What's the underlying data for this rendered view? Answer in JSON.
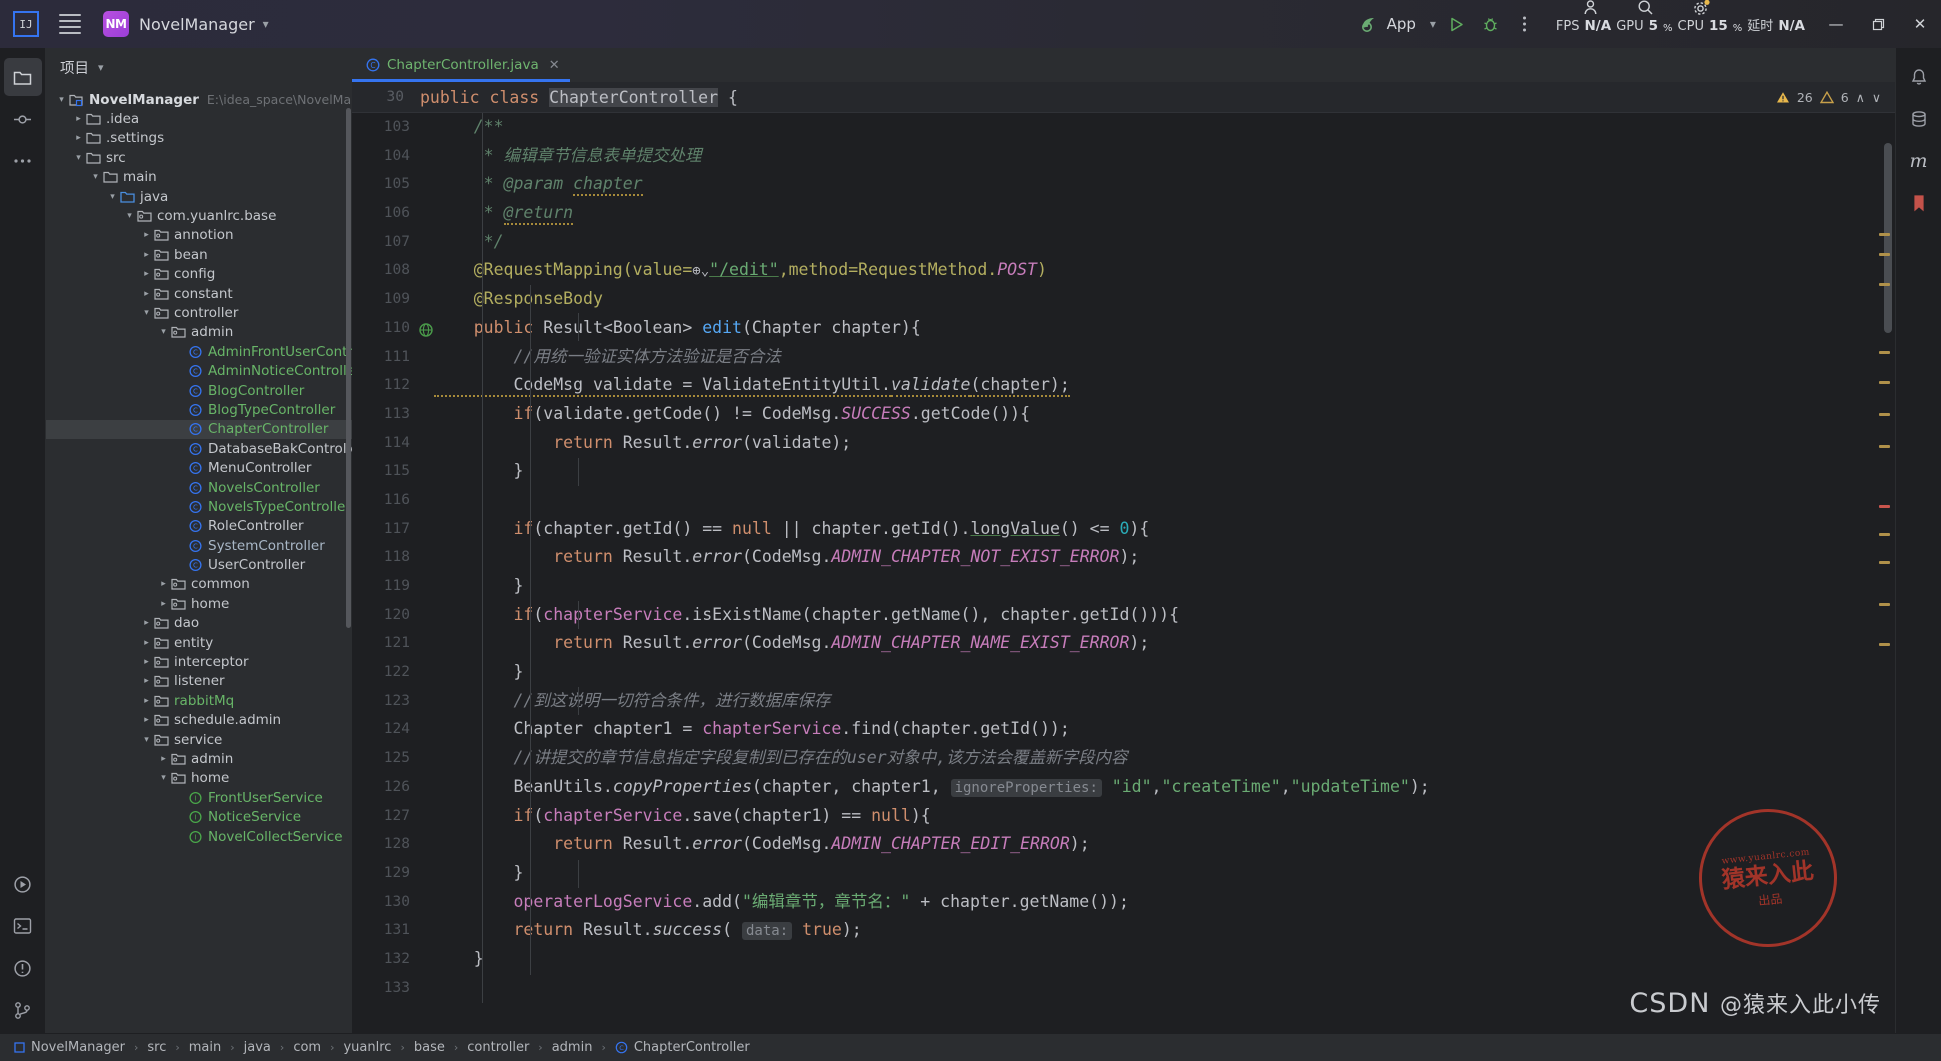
{
  "titlebar": {
    "ide_icon": "intellij-idea-icon",
    "menu_icon": "hamburger-menu-icon",
    "project_initials": "NM",
    "project_name": "NovelManager",
    "run_config": "App",
    "run_icon": "run-icon",
    "debug_icon": "debug-icon",
    "more_icon": "more-vertical-icon",
    "account_icon": "account-icon",
    "search_icon": "search-icon",
    "settings_icon": "gear-icon",
    "perf": [
      {
        "label": "FPS",
        "value": "N/A"
      },
      {
        "label": "GPU",
        "value": "5",
        "unit": "%"
      },
      {
        "label": "CPU",
        "value": "15",
        "unit": "%"
      },
      {
        "label": "延时",
        "value": "N/A"
      }
    ],
    "minimize": "—",
    "maximize": "❐",
    "close": "✕"
  },
  "left_stripe": [
    {
      "name": "project-tool-button",
      "icon": "folder-icon",
      "active": true
    },
    {
      "name": "commit-tool-button",
      "icon": "commit-icon",
      "active": false
    },
    {
      "name": "more-tool-button",
      "icon": "ellipsis-icon",
      "active": false
    },
    {
      "name": "run-tool-button",
      "icon": "run-circle-icon",
      "active": false
    },
    {
      "name": "terminal-tool-button",
      "icon": "terminal-icon",
      "active": false
    },
    {
      "name": "problems-tool-button",
      "icon": "problems-icon",
      "active": false
    },
    {
      "name": "git-tool-button",
      "icon": "git-branch-icon",
      "active": false
    }
  ],
  "right_stripe": [
    {
      "name": "notifications-tool-button",
      "icon": "bell-icon"
    },
    {
      "name": "database-tool-button",
      "icon": "database-icon"
    },
    {
      "name": "maven-tool-button",
      "icon": "maven-m-icon"
    },
    {
      "name": "bookmarks-tool-button",
      "icon": "bookmark-icon"
    }
  ],
  "project_panel": {
    "title": "项目",
    "chevron": "⌄",
    "tree": [
      {
        "depth": 0,
        "arrow": "down",
        "icon": "module-icon",
        "label": "NovelManager",
        "bold": true,
        "path": "E:\\idea_space\\NovelManager",
        "selected": false
      },
      {
        "depth": 1,
        "arrow": "right",
        "icon": "folder-icon",
        "label": ".idea",
        "color": "default"
      },
      {
        "depth": 1,
        "arrow": "right",
        "icon": "folder-icon",
        "label": ".settings",
        "color": "default"
      },
      {
        "depth": 1,
        "arrow": "down",
        "icon": "folder-icon",
        "label": "src",
        "color": "default"
      },
      {
        "depth": 2,
        "arrow": "down",
        "icon": "folder-icon",
        "label": "main",
        "color": "default"
      },
      {
        "depth": 3,
        "arrow": "down",
        "icon": "source-folder-icon",
        "label": "java",
        "color": "default"
      },
      {
        "depth": 4,
        "arrow": "down",
        "icon": "package-icon",
        "label": "com.yuanlrc.base",
        "color": "default"
      },
      {
        "depth": 5,
        "arrow": "right",
        "icon": "package-icon",
        "label": "annotion",
        "color": "default"
      },
      {
        "depth": 5,
        "arrow": "right",
        "icon": "package-icon",
        "label": "bean",
        "color": "default"
      },
      {
        "depth": 5,
        "arrow": "right",
        "icon": "package-icon",
        "label": "config",
        "color": "default"
      },
      {
        "depth": 5,
        "arrow": "right",
        "icon": "package-icon",
        "label": "constant",
        "color": "default"
      },
      {
        "depth": 5,
        "arrow": "down",
        "icon": "package-icon",
        "label": "controller",
        "color": "default"
      },
      {
        "depth": 6,
        "arrow": "down",
        "icon": "package-icon",
        "label": "admin",
        "color": "default"
      },
      {
        "depth": 7,
        "arrow": "none",
        "icon": "class-icon",
        "label": "AdminFrontUserController",
        "color": "green"
      },
      {
        "depth": 7,
        "arrow": "none",
        "icon": "class-icon",
        "label": "AdminNoticeController",
        "color": "green"
      },
      {
        "depth": 7,
        "arrow": "none",
        "icon": "class-icon",
        "label": "BlogController",
        "color": "green"
      },
      {
        "depth": 7,
        "arrow": "none",
        "icon": "class-icon",
        "label": "BlogTypeController",
        "color": "green"
      },
      {
        "depth": 7,
        "arrow": "none",
        "icon": "class-icon",
        "label": "ChapterController",
        "color": "green",
        "selected": true
      },
      {
        "depth": 7,
        "arrow": "none",
        "icon": "class-icon",
        "label": "DatabaseBakController",
        "color": "default"
      },
      {
        "depth": 7,
        "arrow": "none",
        "icon": "class-icon",
        "label": "MenuController",
        "color": "default"
      },
      {
        "depth": 7,
        "arrow": "none",
        "icon": "class-icon",
        "label": "NovelsController",
        "color": "green"
      },
      {
        "depth": 7,
        "arrow": "none",
        "icon": "class-icon",
        "label": "NovelsTypeController",
        "color": "green"
      },
      {
        "depth": 7,
        "arrow": "none",
        "icon": "class-icon",
        "label": "RoleController",
        "color": "default"
      },
      {
        "depth": 7,
        "arrow": "none",
        "icon": "class-icon",
        "label": "SystemController",
        "color": "blue"
      },
      {
        "depth": 7,
        "arrow": "none",
        "icon": "class-icon",
        "label": "UserController",
        "color": "default"
      },
      {
        "depth": 6,
        "arrow": "right",
        "icon": "package-icon",
        "label": "common",
        "color": "default"
      },
      {
        "depth": 6,
        "arrow": "right",
        "icon": "package-icon",
        "label": "home",
        "color": "default"
      },
      {
        "depth": 5,
        "arrow": "right",
        "icon": "package-icon",
        "label": "dao",
        "color": "default"
      },
      {
        "depth": 5,
        "arrow": "right",
        "icon": "package-icon",
        "label": "entity",
        "color": "default"
      },
      {
        "depth": 5,
        "arrow": "right",
        "icon": "package-icon",
        "label": "interceptor",
        "color": "default"
      },
      {
        "depth": 5,
        "arrow": "right",
        "icon": "package-icon",
        "label": "listener",
        "color": "default"
      },
      {
        "depth": 5,
        "arrow": "right",
        "icon": "package-icon",
        "label": "rabbitMq",
        "color": "green"
      },
      {
        "depth": 5,
        "arrow": "right",
        "icon": "package-icon",
        "label": "schedule.admin",
        "color": "default"
      },
      {
        "depth": 5,
        "arrow": "down",
        "icon": "package-icon",
        "label": "service",
        "color": "default"
      },
      {
        "depth": 6,
        "arrow": "right",
        "icon": "package-icon",
        "label": "admin",
        "color": "default"
      },
      {
        "depth": 6,
        "arrow": "down",
        "icon": "package-icon",
        "label": "home",
        "color": "default"
      },
      {
        "depth": 7,
        "arrow": "none",
        "icon": "interface-icon",
        "label": "FrontUserService",
        "color": "green"
      },
      {
        "depth": 7,
        "arrow": "none",
        "icon": "interface-icon",
        "label": "NoticeService",
        "color": "green"
      },
      {
        "depth": 7,
        "arrow": "none",
        "icon": "interface-icon",
        "label": "NovelCollectService",
        "color": "green"
      }
    ]
  },
  "editor": {
    "tab": {
      "label": "ChapterController.java",
      "icon": "java-class-icon",
      "close": "✕"
    },
    "sticky_line_number": "30",
    "inspections": {
      "warnings": "26",
      "weak_warnings": "6",
      "warning_icon": "warning-triangle-icon",
      "weak_icon": "weak-warning-icon",
      "up": "∧",
      "down": "∨"
    },
    "first_line": 103,
    "lines": [
      "103",
      "104",
      "105",
      "106",
      "107",
      "108",
      "109",
      "110",
      "111",
      "112",
      "113",
      "114",
      "115",
      "116",
      "117",
      "118",
      "119",
      "120",
      "121",
      "122",
      "123",
      "124",
      "125",
      "126",
      "127",
      "128",
      "129",
      "130",
      "131",
      "132",
      "133"
    ],
    "code_text": {
      "l103": "    /**",
      "l104": "     * 编辑章节信息表单提交处理",
      "l105": "     * @param chapter",
      "l106": "     * @return",
      "l107": "     */",
      "l108": "    @RequestMapping(value=\"/edit\",method=RequestMethod.POST)",
      "l109": "    @ResponseBody",
      "l110": "    public Result<Boolean> edit(Chapter chapter){",
      "l111": "        //用统一验证实体方法验证是否合法",
      "l112": "        CodeMsg validate = ValidateEntityUtil.validate(chapter);",
      "l113": "        if(validate.getCode() != CodeMsg.SUCCESS.getCode()){",
      "l114": "            return Result.error(validate);",
      "l115": "        }",
      "l116": "",
      "l117": "        if(chapter.getId() == null || chapter.getId().longValue() <= 0){",
      "l118": "            return Result.error(CodeMsg.ADMIN_CHAPTER_NOT_EXIST_ERROR);",
      "l119": "        }",
      "l120": "        if(chapterService.isExistName(chapter.getName(), chapter.getId())){",
      "l121": "            return Result.error(CodeMsg.ADMIN_CHAPTER_NAME_EXIST_ERROR);",
      "l122": "        }",
      "l123": "        //到这说明一切符合条件，进行数据库保存",
      "l124": "        Chapter chapter1 = chapterService.find(chapter.getId());",
      "l125": "        //讲提交的章节信息指定字段复制到已存在的user对象中,该方法会覆盖新字段内容",
      "l126": "        BeanUtils.copyProperties(chapter, chapter1, ignoreProperties: \"id\",\"createTime\",\"updateTime\");",
      "l127": "        if(chapterService.save(chapter1) == null){",
      "l128": "            return Result.error(CodeMsg.ADMIN_CHAPTER_EDIT_ERROR);",
      "l129": "        }",
      "l130": "        operaterLogService.add(\"编辑章节，章节名：\" + chapter.getName());",
      "l131": "        return Result.success( data: true);",
      "l132": "    }",
      "l133": ""
    },
    "sticky_code": {
      "kw1": "public",
      "kw2": "class",
      "name": "ChapterController",
      "brace": "{"
    },
    "inlay_hints": {
      "ignore_properties": "ignoreProperties:",
      "data": "data:"
    },
    "gutter_marks": {
      "line110": "web-mapping-icon"
    }
  },
  "statusbar": {
    "breadcrumbs": [
      {
        "label": "NovelManager",
        "icon": "module-icon"
      },
      {
        "label": "src",
        "icon": "none"
      },
      {
        "label": "main",
        "icon": "none"
      },
      {
        "label": "java",
        "icon": "none"
      },
      {
        "label": "com",
        "icon": "none"
      },
      {
        "label": "yuanlrc",
        "icon": "none"
      },
      {
        "label": "base",
        "icon": "none"
      },
      {
        "label": "controller",
        "icon": "none"
      },
      {
        "label": "admin",
        "icon": "none"
      },
      {
        "label": "ChapterController",
        "icon": "class-icon"
      }
    ],
    "separator": "›"
  },
  "watermark": {
    "stamp_url": "www.yuanlrc.com",
    "stamp_main": "猿来入此",
    "stamp_sub": "出品",
    "csdn_text": "CSDN",
    "csdn_handle": "@猿来入此小传"
  },
  "colors": {
    "accent": "#3574f0",
    "bg_editor": "#1e1f22",
    "bg_panel": "#2b2d30",
    "vcs_modified": "#68b568",
    "keyword": "#cf8e6d",
    "string": "#6aab73",
    "annotation": "#b3ae60",
    "field": "#c77dbb",
    "method": "#56a8f5",
    "number": "#2aacb8"
  }
}
